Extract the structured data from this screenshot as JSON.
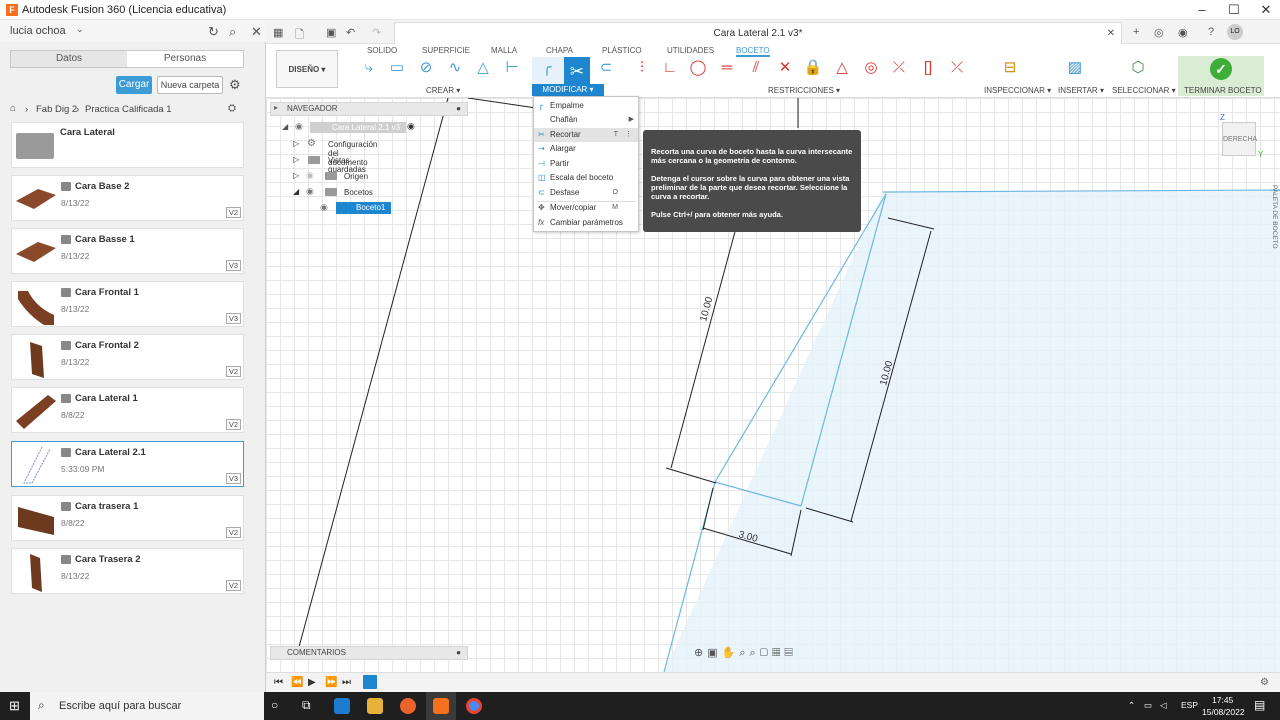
{
  "window": {
    "title": "Autodesk Fusion 360 (Licencia educativa)",
    "doc_tab": "Cara Lateral 2.1 v3*"
  },
  "data_panel": {
    "user": "lucia ochoa",
    "tabs": [
      "Datos",
      "Personas"
    ],
    "upload_label": "Cargar",
    "new_folder_label": "Nueva carpeta",
    "breadcrumb": [
      "Fab Dig 2",
      "Practica Calificada 1"
    ],
    "folder": "Cara Lateral",
    "items": [
      {
        "name": "Cara Base 2",
        "date": "8/13/22",
        "version": "V2"
      },
      {
        "name": "Cara Basse 1",
        "date": "8/13/22",
        "version": "V3"
      },
      {
        "name": "Cara Frontal 1",
        "date": "8/13/22",
        "version": "V3"
      },
      {
        "name": "Cara Frontal 2",
        "date": "8/13/22",
        "version": "V2"
      },
      {
        "name": "Cara Lateral 1",
        "date": "8/8/22",
        "version": "V2"
      },
      {
        "name": "Cara Lateral 2.1",
        "date": "5:33:09 PM",
        "version": "V3"
      },
      {
        "name": "Cara trasera 1",
        "date": "8/8/22",
        "version": "V2"
      },
      {
        "name": "Cara Trasera 2",
        "date": "8/13/22",
        "version": "V2"
      }
    ]
  },
  "toolbar": {
    "workspace": "DISEÑO",
    "tabs": [
      "SOLIDO",
      "SUPERFICIE",
      "MALLA",
      "CHAPA",
      "PLÁSTICO",
      "UTILIDADES",
      "BOCETO"
    ],
    "groups": {
      "crear": "CREAR",
      "modificar": "MODIFICAR",
      "restricciones": "RESTRICCIONES",
      "inspeccionar": "INSPECCIONAR",
      "insertar": "INSERTAR",
      "seleccionar": "SELECCIONAR",
      "terminar": "TERMINAR BOCETO"
    }
  },
  "browser": {
    "title": "NAVEGADOR",
    "root": "Cara Lateral 2.1 v3",
    "nodes": [
      "Configuración del documento",
      "Vistas guardadas",
      "Origen",
      "Bocetos"
    ],
    "sketch": "Boceto1",
    "comments": "COMENTARIOS"
  },
  "modify_menu": [
    {
      "label": "Empalme",
      "shortcut": ""
    },
    {
      "label": "Chaflán",
      "shortcut": ""
    },
    {
      "label": "Recortar",
      "shortcut": "T"
    },
    {
      "label": "Alargar",
      "shortcut": ""
    },
    {
      "label": "Partir",
      "shortcut": ""
    },
    {
      "label": "Escala del boceto",
      "shortcut": ""
    },
    {
      "label": "Desfase",
      "shortcut": "O"
    },
    {
      "label": "Mover/copiar",
      "shortcut": "M"
    },
    {
      "label": "Cambiar parámetros",
      "shortcut": ""
    }
  ],
  "tooltip": {
    "p1": "Recorta una curva de boceto hasta la curva intersecante más cercana o la geometría de contorno.",
    "p2": "Detenga el cursor sobre la curva para obtener una vista preliminar de la parte que desea recortar. Seleccione la curva a recortar.",
    "p3": "Pulse Ctrl+/ para obtener más ayuda."
  },
  "sketch": {
    "dim1": "10.00",
    "dim2": "10.00",
    "dim3": "3.00"
  },
  "viewcube": {
    "face": "DERECHA",
    "axis_z": "Z",
    "axis_y": "Y"
  },
  "side_palette": "PALETA DE BOCETO",
  "taskbar": {
    "search": "Escribe aquí para buscar",
    "lang": "ESP",
    "time": "17:45",
    "date": "15/08/2022"
  }
}
